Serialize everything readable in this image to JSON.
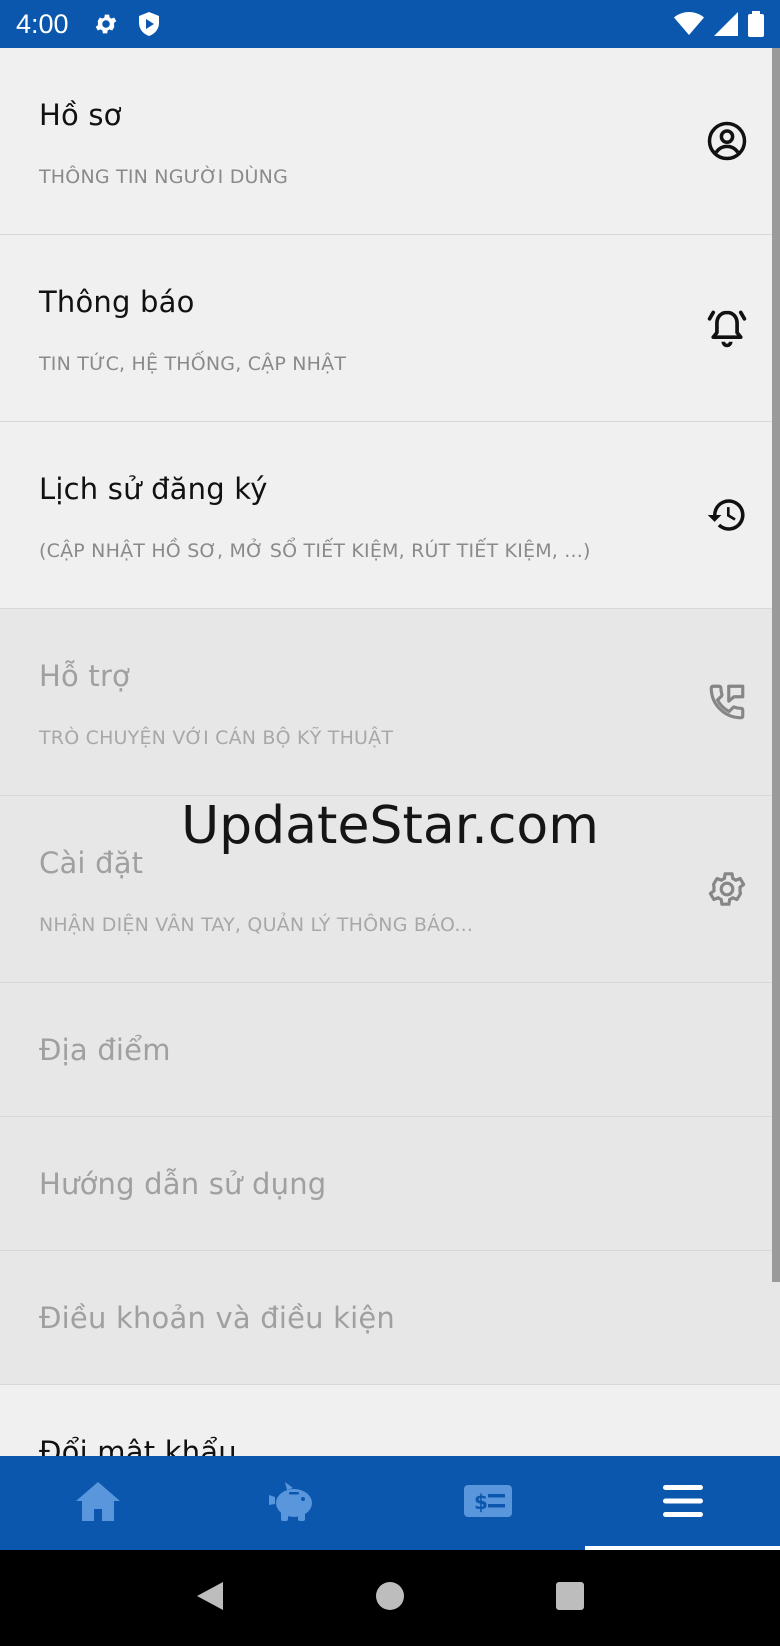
{
  "status_bar": {
    "time": "4:00",
    "icons_left": [
      "gear-icon",
      "shield-play-icon"
    ],
    "icons_right": [
      "wifi-icon",
      "cellular-signal-icon",
      "battery-icon"
    ]
  },
  "menu": {
    "items": [
      {
        "title": "Hồ sơ",
        "subtitle": "THÔNG TIN NGƯỜI DÙNG",
        "icon": "account-circle-icon"
      },
      {
        "title": "Thông báo",
        "subtitle": "TIN TỨC, HỆ THỐNG, CẬP NHẬT",
        "icon": "bell-ringing-icon"
      },
      {
        "title": "Lịch sử đăng ký",
        "subtitle": "(CẬP NHẬT HỒ SƠ, MỞ SỔ TIẾT KIỆM, RÚT TIẾT KIỆM, ...)",
        "icon": "history-icon"
      },
      {
        "title": "Hỗ trợ",
        "subtitle": "TRÒ CHUYỆN VỚI CÁN BỘ KỸ THUẬT",
        "icon": "phone-message-icon"
      },
      {
        "title": "Cài đặt",
        "subtitle": "NHẬN DIỆN VÂN TAY, QUẢN LÝ THÔNG BÁO...",
        "icon": "settings-gear-icon"
      },
      {
        "title": "Địa điểm"
      },
      {
        "title": "Hướng dẫn sử dụng"
      },
      {
        "title": "Điều khoản và điều kiện"
      },
      {
        "title": "Đổi mật khẩu"
      }
    ]
  },
  "watermark": "UpdateStar.com",
  "bottom_nav": {
    "tabs": [
      {
        "icon": "home-icon",
        "active": false
      },
      {
        "icon": "piggy-bank-icon",
        "active": false
      },
      {
        "icon": "money-card-icon",
        "active": false
      },
      {
        "icon": "menu-icon",
        "active": true
      }
    ]
  },
  "colors": {
    "brand_blue": "#0b57ad",
    "background": "#f0f0f0",
    "dim_background": "#e7e7e7"
  }
}
